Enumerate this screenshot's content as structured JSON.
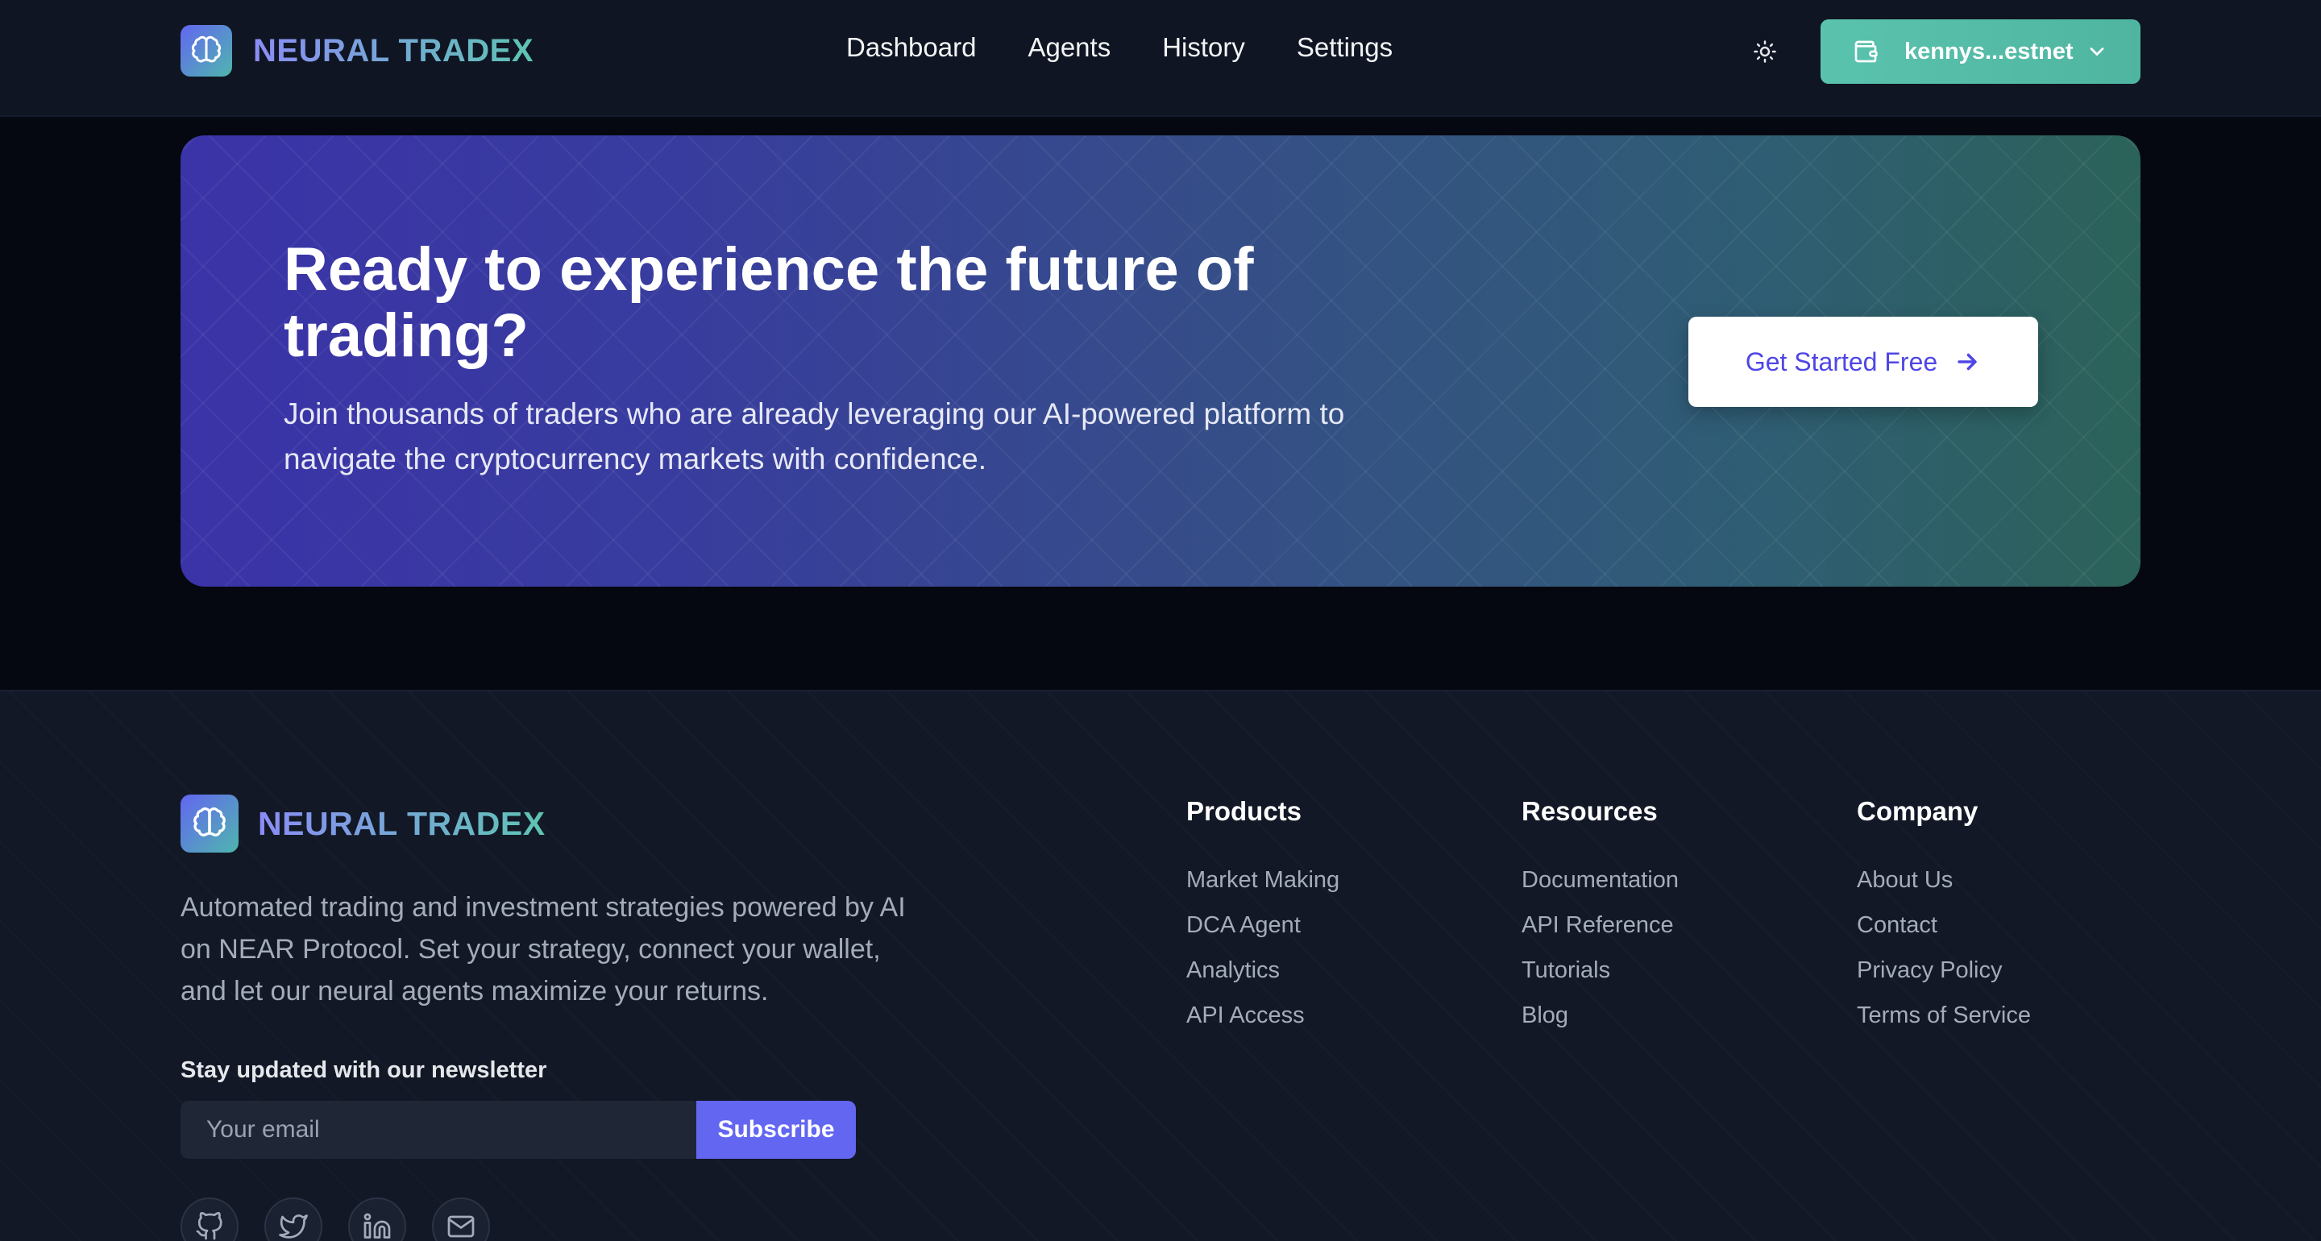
{
  "navbar": {
    "brand": "NEURAL TRADEX",
    "links": [
      "Dashboard",
      "Agents",
      "History",
      "Settings"
    ],
    "theme_icon": "sun-icon",
    "wallet": {
      "label": "kennys...estnet",
      "icon": "wallet-icon",
      "chevron": "chevron-down-icon"
    }
  },
  "cta": {
    "title": "Ready to experience the future of trading?",
    "subtitle": "Join thousands of traders who are already leveraging our AI-powered platform to navigate the cryptocurrency markets with confidence.",
    "button": "Get Started Free",
    "button_icon": "arrow-right-icon"
  },
  "footer": {
    "brand": "NEURAL TRADEX",
    "description": "Automated trading and investment strategies powered by AI on NEAR Protocol. Set your strategy, connect your wallet, and let our neural agents maximize your returns.",
    "newsletter": {
      "title": "Stay updated with our newsletter",
      "placeholder": "Your email",
      "button": "Subscribe"
    },
    "socials": [
      "github-icon",
      "twitter-icon",
      "linkedin-icon",
      "mail-icon"
    ],
    "columns": [
      {
        "title": "Products",
        "links": [
          "Market Making",
          "DCA Agent",
          "Analytics",
          "API Access"
        ]
      },
      {
        "title": "Resources",
        "links": [
          "Documentation",
          "API Reference",
          "Tutorials",
          "Blog"
        ]
      },
      {
        "title": "Company",
        "links": [
          "About Us",
          "Contact",
          "Privacy Policy",
          "Terms of Service"
        ]
      }
    ]
  },
  "colors": {
    "accent": "#6366f1",
    "teal": "#4fb5a1",
    "background": "#050810",
    "footer_bg": "#121826"
  }
}
